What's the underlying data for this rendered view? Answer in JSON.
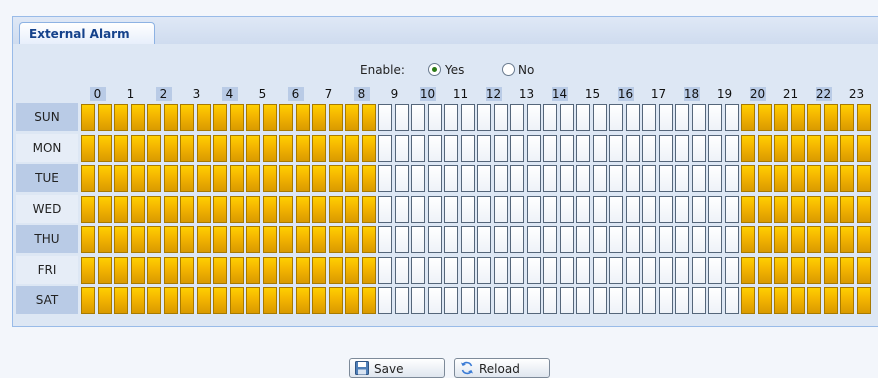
{
  "tab": {
    "label": "External Alarm"
  },
  "enable": {
    "label": "Enable:",
    "options": [
      {
        "label": "Yes",
        "checked": true
      },
      {
        "label": "No",
        "checked": false
      }
    ]
  },
  "hours": [
    "0",
    "1",
    "2",
    "3",
    "4",
    "5",
    "6",
    "7",
    "8",
    "9",
    "10",
    "11",
    "12",
    "13",
    "14",
    "15",
    "16",
    "17",
    "18",
    "19",
    "20",
    "21",
    "22",
    "23"
  ],
  "days": [
    "SUN",
    "MON",
    "TUE",
    "WED",
    "THU",
    "FRI",
    "SAT"
  ],
  "schedule": {
    "active_hours": [
      0,
      1,
      2,
      3,
      4,
      5,
      6,
      7,
      8,
      20,
      21,
      22,
      23
    ],
    "slots_per_hour": 2
  },
  "buttons": {
    "save": "Save",
    "reload": "Reload"
  },
  "colors": {
    "active": "#f3b400",
    "inactive": "#ffffff",
    "header_shade": "#b9cbe6"
  },
  "icons": {
    "save": "floppy-disk-icon",
    "reload": "reload-arrows-icon"
  }
}
